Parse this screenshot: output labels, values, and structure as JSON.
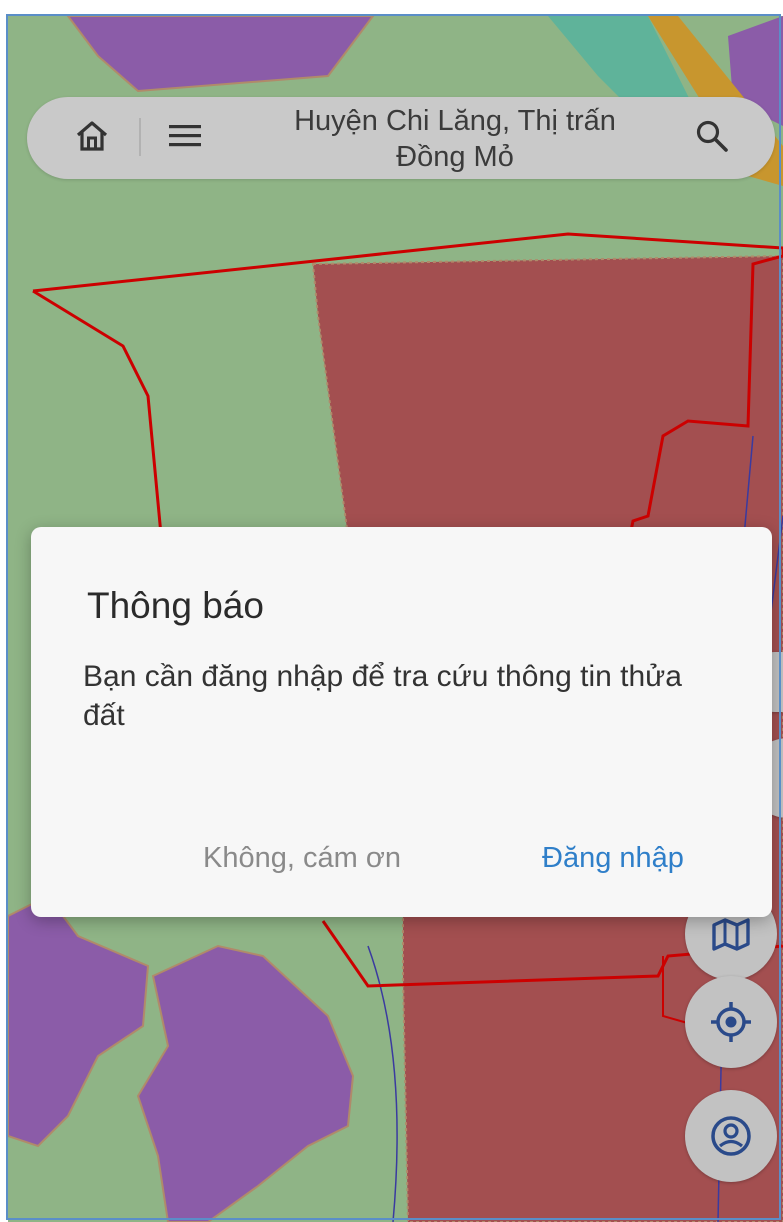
{
  "search_bar": {
    "location_line1": "Huyện Chi Lăng, Thị trấn",
    "location_line2": "Đồng Mỏ"
  },
  "dialog": {
    "title": "Thông báo",
    "message": "Bạn cần đăng nhập để tra cứu thông tin thửa đất",
    "cancel_label": "Không, cám ơn",
    "confirm_label": "Đăng nhập"
  },
  "icons": {
    "home": "home-icon",
    "menu": "menu-icon",
    "search": "search-icon",
    "layers": "map-layers-icon",
    "locate": "my-location-icon",
    "account": "account-icon"
  },
  "colors": {
    "map_green": "#8fb486",
    "parcel_red": "#a34f50",
    "zone_purple": "#8b5ca8",
    "road_orange": "#c8962e",
    "teal": "#5fb39a",
    "boundary_red": "#cc0000",
    "accent_blue": "#2f7fc9"
  }
}
